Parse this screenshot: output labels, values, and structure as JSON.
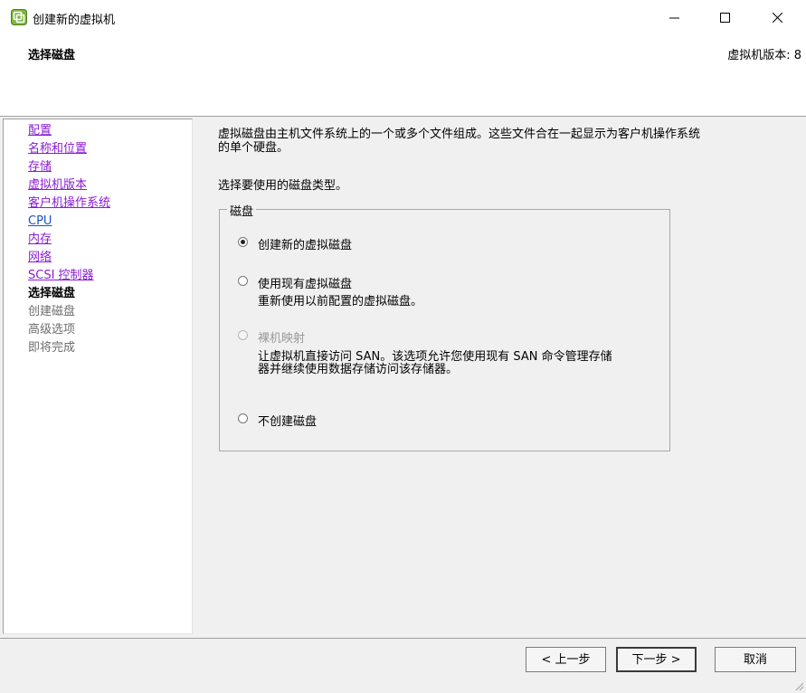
{
  "window": {
    "title": "创建新的虚拟机",
    "icon": "vsphere-app-icon"
  },
  "header": {
    "step_title": "选择磁盘",
    "vm_version": "虚拟机版本: 8"
  },
  "sidebar": {
    "items": [
      {
        "label": "配置",
        "state": "visited"
      },
      {
        "label": "名称和位置",
        "state": "visited"
      },
      {
        "label": "存储",
        "state": "visited"
      },
      {
        "label": "虚拟机版本",
        "state": "visited"
      },
      {
        "label": "客户机操作系统",
        "state": "visited"
      },
      {
        "label": "CPU",
        "state": "link"
      },
      {
        "label": "内存",
        "state": "visited"
      },
      {
        "label": "网络",
        "state": "visited"
      },
      {
        "label": "SCSI 控制器",
        "state": "visited"
      },
      {
        "label": "选择磁盘",
        "state": "current"
      },
      {
        "label": "创建磁盘",
        "state": "disabled"
      },
      {
        "label": "高级选项",
        "state": "disabled"
      },
      {
        "label": "即将完成",
        "state": "disabled"
      }
    ]
  },
  "main": {
    "description_line1": "虚拟磁盘由主机文件系统上的一个或多个文件组成。这些文件合在一起显示为客户机操作系统",
    "description_line2": "的单个硬盘。",
    "prompt": "选择要使用的磁盘类型。",
    "group_label": "磁盘",
    "options": [
      {
        "label": "创建新的虚拟磁盘",
        "checked": true,
        "enabled": true
      },
      {
        "label": "使用现有虚拟磁盘",
        "checked": false,
        "enabled": true,
        "desc": "重新使用以前配置的虚拟磁盘。"
      },
      {
        "label": "裸机映射",
        "checked": false,
        "enabled": false,
        "desc_line1": "让虚拟机直接访问 SAN。该选项允许您使用现有 SAN 命令管理存储",
        "desc_line2": "器并继续使用数据存储访问该存储器。"
      },
      {
        "label": "不创建磁盘",
        "checked": false,
        "enabled": true
      }
    ]
  },
  "footer": {
    "back_label": "< 上一步",
    "next_label": "下一步 >",
    "cancel_label": "取消"
  }
}
